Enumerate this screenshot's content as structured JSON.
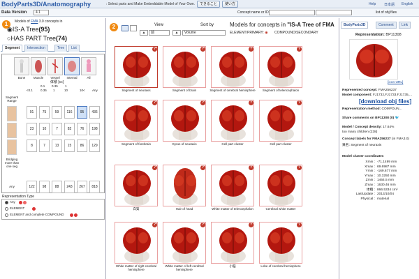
{
  "header": {
    "logo": "BodyParts3D/Anatomography",
    "tagline": ": Select parts and Make Embeddable Model of Your Own.",
    "btn1": "できること",
    "btn2": "使い方",
    "help": "Help",
    "lang1": "日本語",
    "lang2": "English"
  },
  "toolbar": {
    "data_version_label": "Data Version",
    "data_version": "4.1",
    "concept_label": "Concept name or ID :",
    "objlist": "list of obj files"
  },
  "left": {
    "step": "1",
    "models_prefix": "Models of",
    "fma": "FMA",
    "models_suffix": "3.0 concepts",
    "models_in": "in",
    "tree1_label": "IS-A Tree",
    "tree1_count": "(95)",
    "tree2_label": "HAS PART Tree",
    "tree2_count": "(74)",
    "tabs": [
      "Segment",
      "Intersection",
      "Tree",
      "List"
    ],
    "categories": [
      "Bone",
      "Muscle",
      "Vessel",
      "Internal",
      "All"
    ],
    "vol_header": "体積 [cc]",
    "vol_cols": [
      "<0.1",
      "0.1",
      "0.35",
      "1",
      "10",
      "10<",
      "Any"
    ],
    "vol_sub": [
      "0.35",
      "1",
      "10"
    ],
    "row_labels": [
      "Segment Range",
      "",
      "",
      "Bridging more than one seg",
      "Any"
    ],
    "grid": [
      [
        "91",
        "75",
        "59",
        "116",
        "95",
        "436"
      ],
      [
        "23",
        "10",
        "7",
        "82",
        "76",
        "198"
      ],
      [
        "8",
        "7",
        "13",
        "15",
        "86",
        "129"
      ],
      [
        "122",
        "98",
        "88",
        "243",
        "267",
        "818"
      ]
    ],
    "rep_label": "Representation Type",
    "rep_opts": [
      "Any",
      "ELEMENT",
      "ELEMENT and complete COMPOUND"
    ]
  },
  "middle": {
    "step": "2",
    "view_label": "View",
    "view_value": "前",
    "sort_label": "Sort by",
    "sort_value": "Volume",
    "title_prefix": "Models for concepts in",
    "title_tree": "\"IS-A Tree of FMA",
    "element_label": "ELEMENT/PRIMARY:",
    "compound_label": "COMPOUND/SECONDARY",
    "captions": [
      "Segment of neuraxis",
      "Segment of brain",
      "Segment of cerebral hemisphere",
      "Segment of telencephalon",
      "Segment of forebrain",
      "Gyrus of neuraxis",
      "Cell part cluster",
      "Cell part cluster",
      "白質",
      "Hair of head",
      "White matter of telencephalon",
      "Cerebral white matter",
      "White matter of right cerebral hemisphere",
      "White matter of left cerebral hemisphere",
      "小脳",
      "Lobe of cerebral hemisphere"
    ]
  },
  "right": {
    "tabs": [
      "BodyParts3D",
      "Comment",
      "Link"
    ],
    "rep_label": "Representation:",
    "rep_id": "BP11308",
    "icon_url": "[icon URL]",
    "concept_label": "Represented concept:",
    "concept_val": "FMA256237",
    "component_label": "Model component:",
    "component_val": "FJ1732,FJ1733,FJ1735,...",
    "download": "[download obj files]",
    "method_label": "Representation method:",
    "method_val": "COMPOUN...",
    "share": "Share comments on BP11308 (0)",
    "density_label": "Model / Concept density:",
    "density_val": "17.64%",
    "density_note": "too many children (238)",
    "labels_label": "Concept labels for FMA256237",
    "labels_note": "(in FMA3.0)",
    "label_ja": "異名:",
    "label_val": "Segment of neuraxis",
    "coords_title": "Model cluster coordinates",
    "coords": [
      [
        "Xmin :",
        "-71.1499 mm"
      ],
      [
        "Xmax :",
        "69.6987 mm"
      ],
      [
        "Ymin :",
        "-169.677 mm"
      ],
      [
        "Ymax :",
        "10.3250 mm"
      ],
      [
        "Zmin :",
        "1464.5 mm"
      ],
      [
        "Zmax :",
        "1630.46 mm"
      ],
      [
        "体積 :",
        "866.5334 cm³"
      ],
      [
        "LastUpdate :",
        "2013/10/04"
      ],
      [
        "Physical :",
        "material"
      ]
    ]
  }
}
